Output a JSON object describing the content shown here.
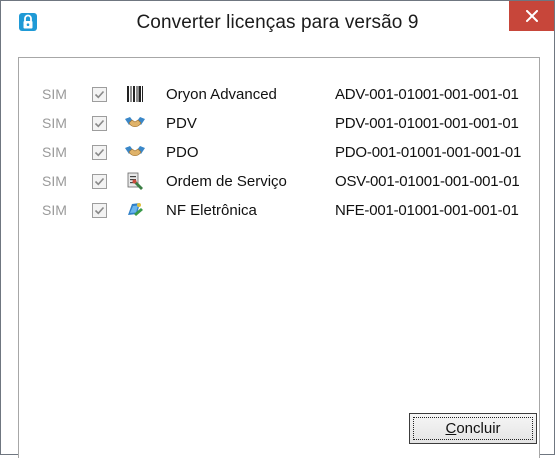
{
  "window": {
    "title": "Converter licenças para versão 9"
  },
  "rows": [
    {
      "status": "SIM",
      "checked": true,
      "icon": "barcode-icon",
      "name": "Oryon Advanced",
      "code": "ADV-001-01001-001-001-01"
    },
    {
      "status": "SIM",
      "checked": true,
      "icon": "pdv-handshake-icon",
      "name": "PDV",
      "code": "PDV-001-01001-001-001-01"
    },
    {
      "status": "SIM",
      "checked": true,
      "icon": "pdo-handshake-icon",
      "name": "PDO",
      "code": "PDO-001-01001-001-001-01"
    },
    {
      "status": "SIM",
      "checked": true,
      "icon": "service-order-icon",
      "name": "Ordem de Serviço",
      "code": "OSV-001-01001-001-001-01"
    },
    {
      "status": "SIM",
      "checked": true,
      "icon": "nfe-icon",
      "name": "NF Eletrônica",
      "code": "NFE-001-01001-001-001-01"
    }
  ],
  "footer": {
    "conclude_label": "Concluir"
  },
  "colors": {
    "close_button": "#c7463a",
    "app_icon": "#1f9ad6",
    "status_text": "#9a9a9a"
  }
}
